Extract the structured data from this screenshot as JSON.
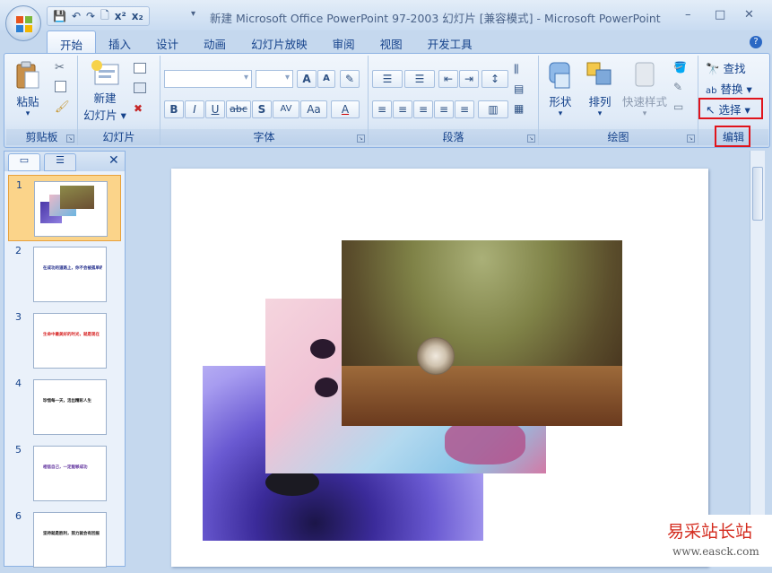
{
  "title": "新建 Microsoft Office PowerPoint 97-2003 幻灯片 [兼容模式] - Microsoft PowerPoint",
  "qat": {
    "save": "💾",
    "undo": "↶",
    "redo": "↷",
    "preview": "🗋",
    "superscript": "x²",
    "subscript": "x₂",
    "more": "▾"
  },
  "window_controls": {
    "minimize": "–",
    "restore": "□",
    "close": "✕"
  },
  "tabs": [
    "开始",
    "插入",
    "设计",
    "动画",
    "幻灯片放映",
    "审阅",
    "视图",
    "开发工具"
  ],
  "help": "?",
  "groups": {
    "clipboard": {
      "label": "剪贴板",
      "paste": "粘贴"
    },
    "slides": {
      "label": "幻灯片",
      "new_slide_1": "新建",
      "new_slide_2": "幻灯片"
    },
    "font": {
      "label": "字体",
      "bold": "B",
      "italic": "I",
      "underline": "U",
      "strike": "abc",
      "shadow": "S",
      "spacing": "AV",
      "case": "Aa",
      "color": "A",
      "grow": "A",
      "shrink": "A"
    },
    "paragraph": {
      "label": "段落"
    },
    "drawing": {
      "label": "绘图",
      "shapes": "形状",
      "arrange": "排列",
      "quick_styles": "快速样式"
    },
    "editing": {
      "label": "编辑",
      "find": "查找",
      "replace": "替换",
      "select": "选择"
    }
  },
  "slides": [
    {
      "num": "1"
    },
    {
      "num": "2",
      "text": "在成功的道路上，你不会被孤单的",
      "color": "#1f2a8a"
    },
    {
      "num": "3",
      "text": "生命中最美好的时光，就是现在",
      "color": "#d62020"
    },
    {
      "num": "4",
      "text": "珍惜每一天，活出精彩人生",
      "color": "#111111"
    },
    {
      "num": "5",
      "text": "相信自己，一定能够成功",
      "color": "#5a2a9a"
    },
    {
      "num": "6",
      "text": "坚持就是胜利，努力就会有回报",
      "color": "#111111"
    }
  ],
  "watermark": {
    "line1": "易采站长站",
    "line2": "www.easck.com"
  },
  "colors": {
    "accent_red": "#e0141c",
    "ribbon_text": "#15428b"
  }
}
